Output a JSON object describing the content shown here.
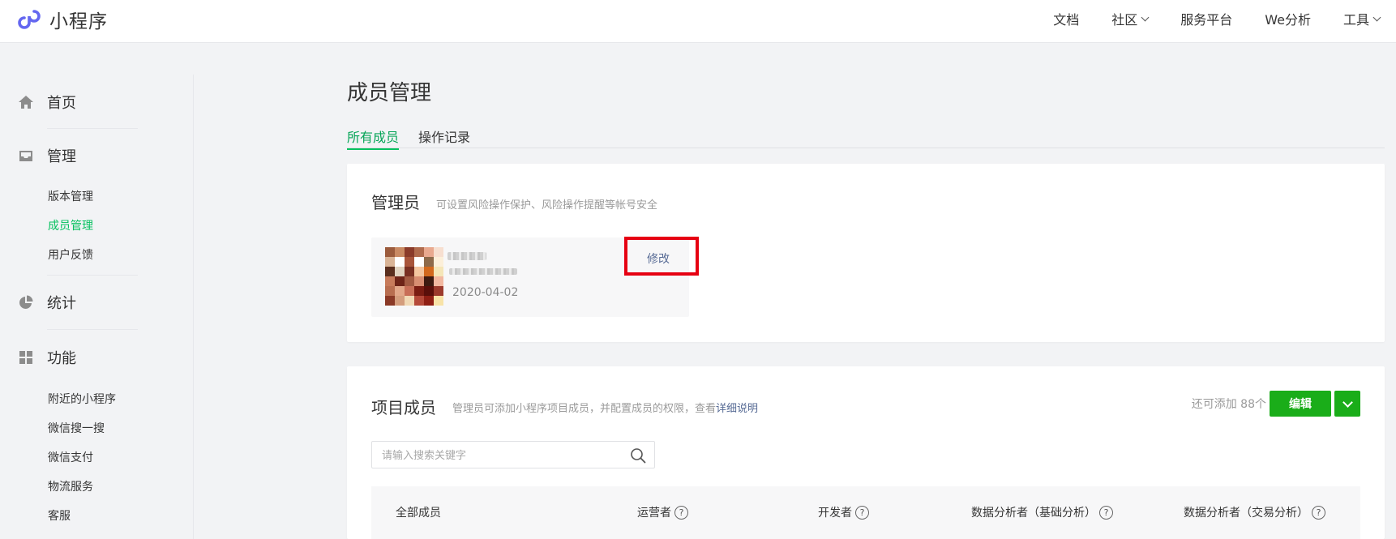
{
  "header": {
    "logo_text": "小程序",
    "nav": [
      {
        "label": "文档"
      },
      {
        "label": "社区",
        "has_caret": true
      },
      {
        "label": "服务平台"
      },
      {
        "label": "We分析"
      },
      {
        "label": "工具",
        "has_caret": true
      }
    ]
  },
  "sidebar": {
    "home": "首页",
    "manage": "管理",
    "manage_items": [
      "版本管理",
      "成员管理",
      "用户反馈"
    ],
    "stats": "统计",
    "features": "功能",
    "feature_items": [
      "附近的小程序",
      "微信搜一搜",
      "微信支付",
      "物流服务",
      "客服"
    ],
    "active_item": "成员管理"
  },
  "main": {
    "title": "成员管理",
    "tabs": [
      "所有成员",
      "操作记录"
    ],
    "active_tab": "所有成员",
    "admin": {
      "title": "管理员",
      "desc": "可设置风险操作保护、风险操作提醒等帐号安全",
      "date": "2020-04-02",
      "edit_label": "修改"
    },
    "members": {
      "title": "项目成员",
      "desc": "管理员可添加小程序项目成员，并配置成员的权限，查看",
      "desc_link": "详细说明",
      "remaining": "还可添加 88个",
      "edit_button": "编辑",
      "search_placeholder": "请输入搜索关键字",
      "columns": [
        "全部成员",
        "运营者",
        "开发者",
        "数据分析者（基础分析）",
        "数据分析者（交易分析）"
      ]
    }
  },
  "colors": {
    "accent_green": "#07c160",
    "button_green": "#1aad19",
    "link_blue": "#576b95",
    "highlight_red": "#e60012"
  }
}
